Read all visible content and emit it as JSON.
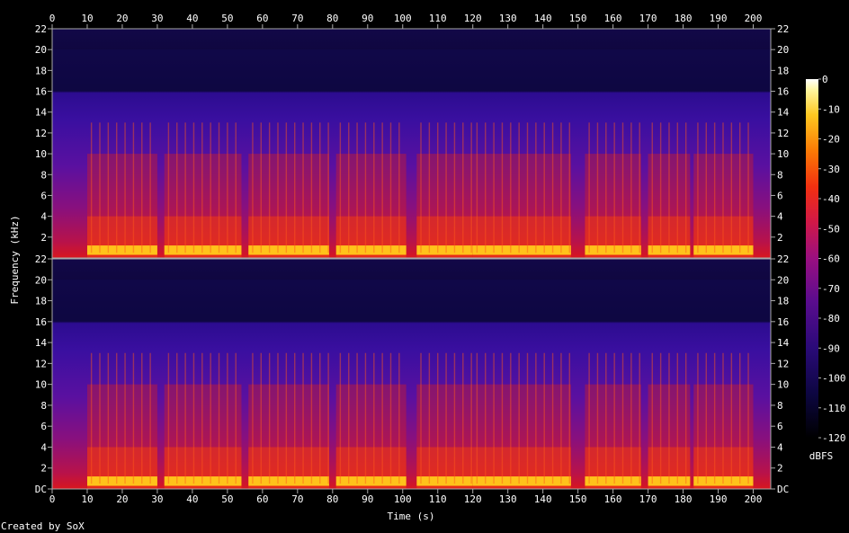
{
  "chart_data": {
    "type": "heatmap",
    "title": "",
    "xlabel": "Time (s)",
    "ylabel": "Frequency (kHz)",
    "xlim": [
      0,
      205
    ],
    "ylim": [
      0,
      22
    ],
    "x_ticks": [
      "0",
      "10",
      "20",
      "30",
      "40",
      "50",
      "60",
      "70",
      "80",
      "90",
      "100",
      "110",
      "120",
      "130",
      "140",
      "150",
      "160",
      "170",
      "180",
      "190",
      "200"
    ],
    "y_ticks": [
      "DC",
      "2",
      "4",
      "6",
      "8",
      "10",
      "12",
      "14",
      "16",
      "18",
      "20",
      "22"
    ],
    "channels": [
      {
        "name": "top channel"
      },
      {
        "name": "bottom channel"
      }
    ],
    "colorbar": {
      "label": "dBFS",
      "range": [
        -120,
        0
      ],
      "ticks": [
        "0",
        "-10",
        "-20",
        "-30",
        "-40",
        "-50",
        "-60",
        "-70",
        "-80",
        "-90",
        "-100",
        "-110",
        "-120"
      ]
    },
    "lowpass_cutoff_khz": 16,
    "bright_segments_s": [
      [
        10,
        30
      ],
      [
        32,
        54
      ],
      [
        56,
        79
      ],
      [
        81,
        101
      ],
      [
        104,
        120
      ],
      [
        120,
        148
      ],
      [
        152,
        168
      ],
      [
        170,
        182
      ],
      [
        183,
        200
      ]
    ],
    "footer": "Created by SoX"
  }
}
